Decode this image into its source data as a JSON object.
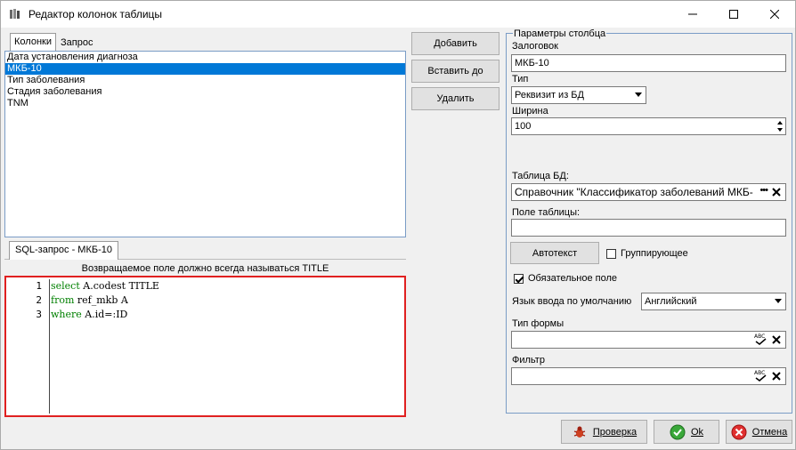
{
  "window": {
    "title": "Редактор колонок таблицы"
  },
  "left_tabs": {
    "columns_label": "Колонки",
    "query_label": "Запрос"
  },
  "columns_list": {
    "items": [
      {
        "label": "Дата установления диагноза",
        "selected": false
      },
      {
        "label": "МКБ-10",
        "selected": true
      },
      {
        "label": "Тип заболевания",
        "selected": false
      },
      {
        "label": "Стадия заболевания",
        "selected": false
      },
      {
        "label": "TNM",
        "selected": false
      }
    ]
  },
  "sql_panel": {
    "tab_label": "SQL-запрос - МКБ-10",
    "hint": "Возвращаемое поле должно всегда называться TITLE",
    "line_numbers": [
      "1",
      "2",
      "3"
    ],
    "lines": [
      {
        "keyword": "select",
        "rest": " A.codest TITLE"
      },
      {
        "keyword": "from",
        "rest": " ref_mkb A"
      },
      {
        "keyword": "where",
        "rest": " A.id=:ID"
      }
    ],
    "keyword_color": "#008000"
  },
  "actions": {
    "add_label": "Добавить",
    "insert_label": "Вставить до",
    "delete_label": "Удалить"
  },
  "params": {
    "group_title": "Параметры столбца",
    "caption_label": "Залоговок",
    "caption_value": "МКБ-10",
    "type_label": "Тип",
    "type_value": "Реквизит из БД",
    "width_label": "Ширина",
    "width_value": "100",
    "db_table_label": "Таблица БД:",
    "db_table_value": "Справочник \"Классификатор заболеваний МКБ-",
    "table_field_label": "Поле таблицы:",
    "table_field_value": "",
    "autotext_label": "Автотекст",
    "grouping_label": "Группирующее",
    "grouping_checked": false,
    "required_label": "Обязательное поле",
    "required_checked": true,
    "input_lang_label": "Язык ввода по умолчанию",
    "input_lang_value": "Английский",
    "form_type_label": "Тип формы",
    "form_type_value": "",
    "filter_label": "Фильтр",
    "filter_value": ""
  },
  "footer": {
    "check_label": "Проверка",
    "ok_label": "Ok",
    "cancel_label": "Отмена"
  }
}
